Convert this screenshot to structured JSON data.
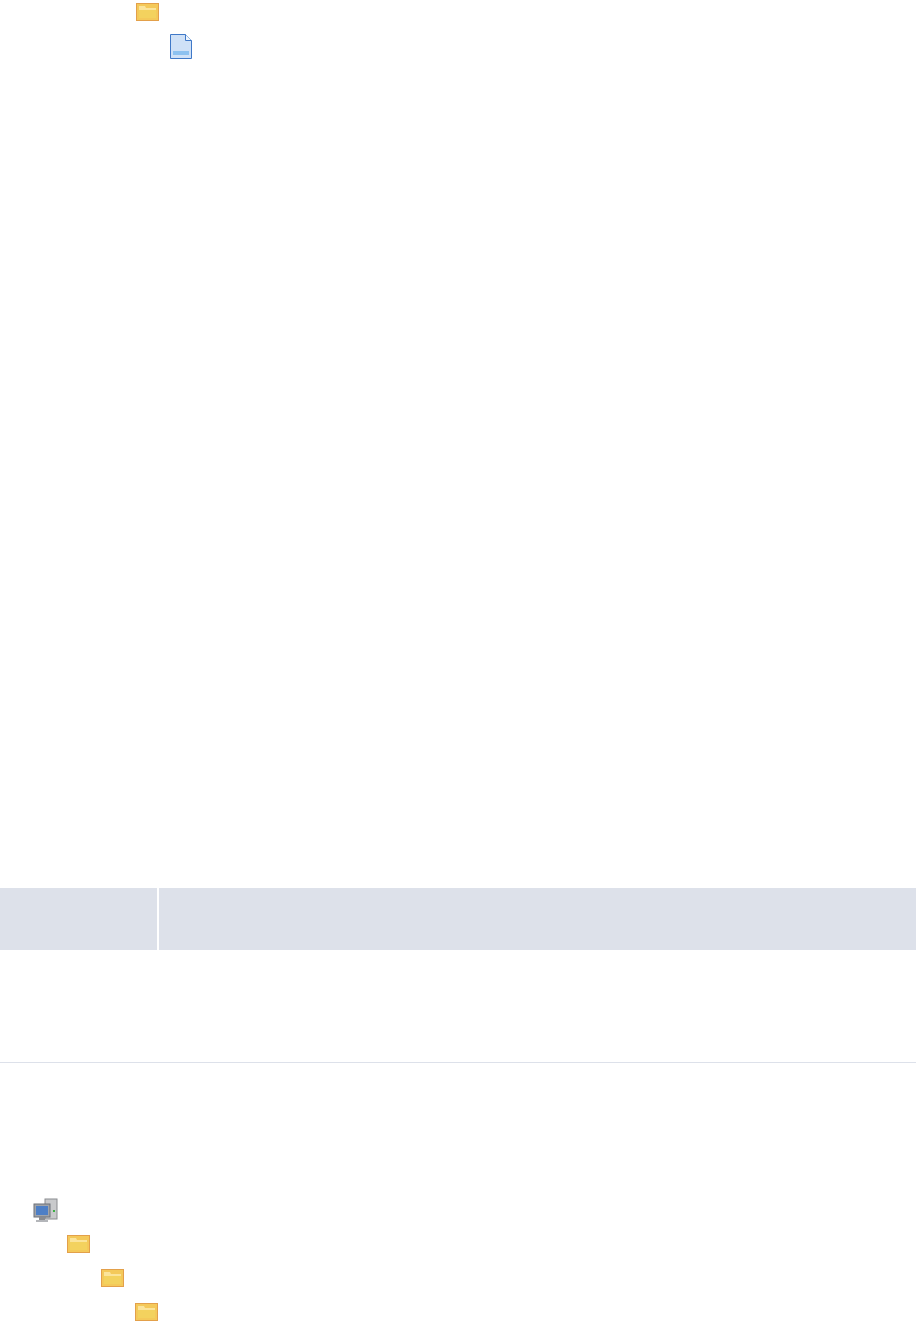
{
  "top_tree": {
    "items": [
      {
        "kind": "folder",
        "children": [
          {
            "kind": "file"
          }
        ]
      }
    ]
  },
  "table_header": {
    "columns": [
      {
        "kind": "narrow"
      },
      {
        "kind": "wide"
      }
    ]
  },
  "bottom_tree": {
    "items": [
      {
        "kind": "computer",
        "children": [
          {
            "kind": "folder",
            "children": [
              {
                "kind": "folder",
                "children": [
                  {
                    "kind": "folder"
                  }
                ]
              }
            ]
          }
        ]
      }
    ]
  }
}
